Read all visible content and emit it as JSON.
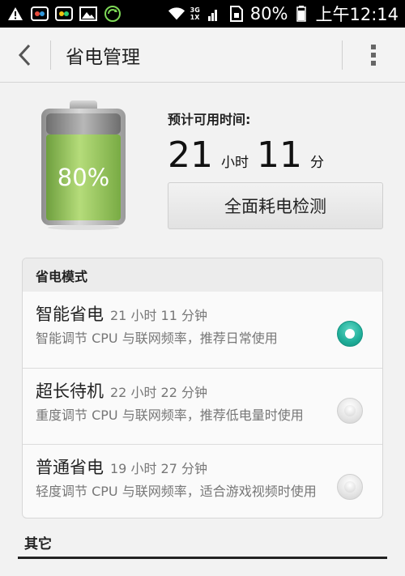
{
  "status_bar": {
    "network_top": "3G",
    "network_bottom": "1X",
    "battery_percent": "80%",
    "time": "上午12:14",
    "icons": [
      "warning-icon",
      "cloud-sync-icon",
      "cloud-sync-icon",
      "image-icon",
      "refresh-icon",
      "wifi-icon",
      "signal-icon",
      "sim-icon",
      "battery-icon"
    ]
  },
  "action_bar": {
    "title": "省电管理"
  },
  "battery": {
    "level_text": "80%",
    "level_fraction": 0.8,
    "fill_color": "#8cc152"
  },
  "estimate": {
    "label": "预计可用时间:",
    "hours": "21",
    "hours_unit": "小时",
    "minutes": "11",
    "minutes_unit": "分",
    "detect_button": "全面耗电检测"
  },
  "modes": {
    "header": "省电模式",
    "items": [
      {
        "name": "智能省电",
        "time": "21 小时 11 分钟",
        "desc": "智能调节 CPU 与联网频率，推荐日常使用",
        "selected": true
      },
      {
        "name": "超长待机",
        "time": "22 小时 22 分钟",
        "desc": "重度调节 CPU 与联网频率，推荐低电量时使用",
        "selected": false
      },
      {
        "name": "普通省电",
        "time": "19 小时 27 分钟",
        "desc": "轻度调节 CPU 与联网频率，适合游戏视频时使用",
        "selected": false
      }
    ],
    "accent_color": "#1fae99"
  },
  "other": {
    "label": "其它"
  }
}
